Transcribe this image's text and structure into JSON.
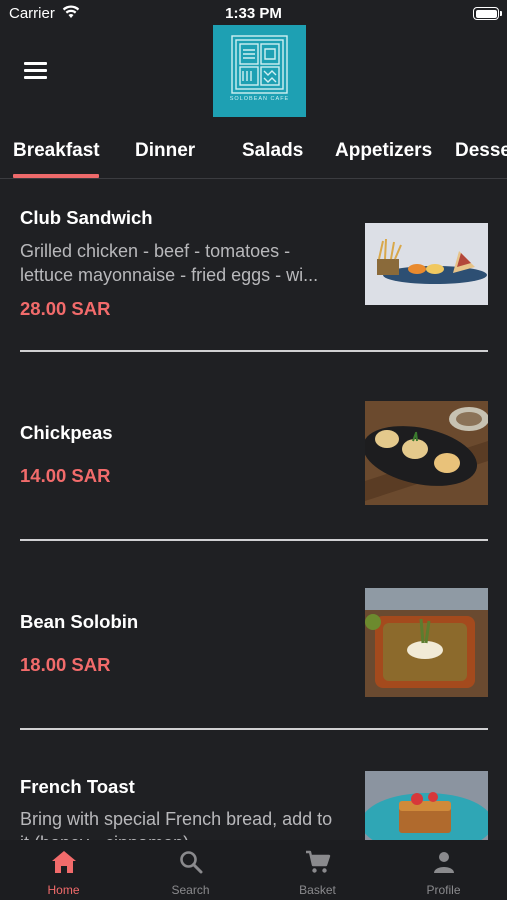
{
  "status_bar": {
    "carrier": "Carrier",
    "time": "1:33 PM"
  },
  "header": {
    "logo_text": "SOLOBEAN CAFE"
  },
  "tabs": [
    {
      "label": "Breakfast",
      "active": true
    },
    {
      "label": "Dinner"
    },
    {
      "label": "Salads"
    },
    {
      "label": "Appetizers"
    },
    {
      "label": "Desse"
    }
  ],
  "menu_items": [
    {
      "name": "Club Sandwich",
      "description": "Grilled chicken - beef - tomatoes - lettuce mayonnaise - fried eggs - wi...",
      "price": "28.00 SAR"
    },
    {
      "name": "Chickpeas",
      "price": "14.00 SAR"
    },
    {
      "name": "Bean Solobin",
      "price": "18.00 SAR"
    },
    {
      "name": "French Toast",
      "description": "Bring with special French bread, add to it (honey - cinnamon)"
    }
  ],
  "bottom_nav": [
    {
      "label": "Home",
      "icon": "home-icon",
      "active": true
    },
    {
      "label": "Search",
      "icon": "search-icon"
    },
    {
      "label": "Basket",
      "icon": "cart-icon"
    },
    {
      "label": "Profile",
      "icon": "person-icon"
    }
  ],
  "colors": {
    "accent": "#f26b6b",
    "background": "#1f2023",
    "logo_bg": "#1ea0b3"
  }
}
